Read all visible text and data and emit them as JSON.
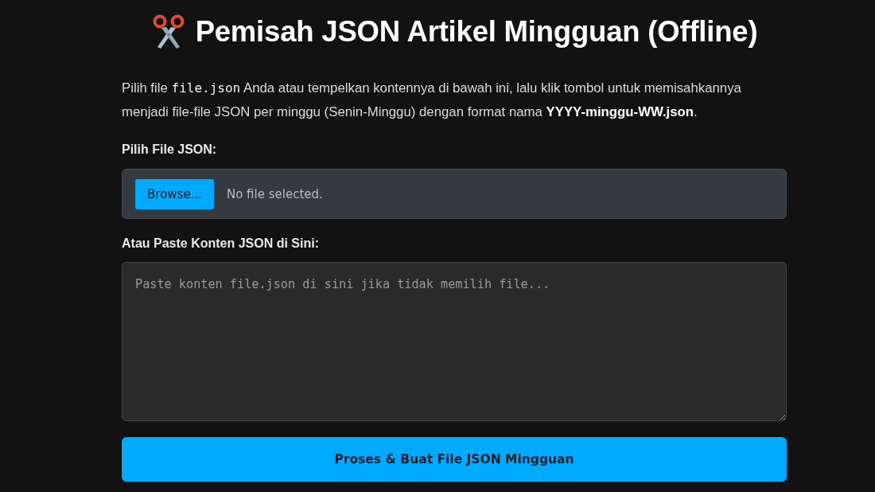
{
  "title": "Pemisah JSON Artikel Mingguan (Offline)",
  "description": [
    {
      "kind": "text",
      "text": "Pilih file "
    },
    {
      "kind": "code",
      "text": "file.json"
    },
    {
      "kind": "text",
      "text": " Anda atau tempelkan kontennya di bawah ini, lalu klik tombol untuk memisahkannya menjadi file-file JSON per minggu (Senin-Minggu) dengan format nama **YYYY-minggu-WW.json**."
    }
  ],
  "file_section": {
    "label": "Pilih File JSON:",
    "button": "Browse...",
    "status": "No file selected."
  },
  "paste_section": {
    "label": "Atau Paste Konten JSON di Sini:",
    "placeholder": "Paste konten file.json di sini jika tidak memilih file..."
  },
  "submit_button": "Proses & Buat File JSON Mingguan"
}
